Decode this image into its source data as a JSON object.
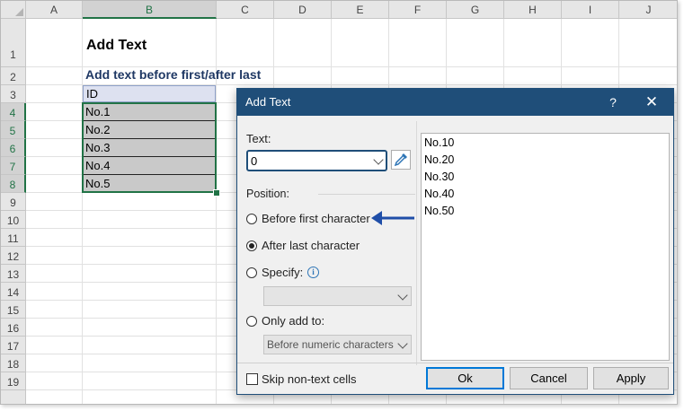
{
  "sheet": {
    "columns": [
      "A",
      "B",
      "C",
      "D",
      "E",
      "F",
      "G",
      "H",
      "I",
      "J"
    ],
    "rows": [
      "1",
      "2",
      "3",
      "4",
      "5",
      "6",
      "7",
      "8",
      "9",
      "10",
      "11",
      "12",
      "13",
      "14",
      "15",
      "16",
      "17",
      "18",
      "19"
    ],
    "title": "Add Text",
    "subtitle": "Add text before first/after last",
    "header": "ID",
    "data": [
      "No.1",
      "No.2",
      "No.3",
      "No.4",
      "No.5"
    ],
    "selection_color": "#217346"
  },
  "dialog": {
    "title": "Add Text",
    "help": "?",
    "close": "✕",
    "text_label": "Text:",
    "text_value": "0",
    "position_label": "Position:",
    "options": {
      "before_first": "Before first character",
      "after_last": "After last character",
      "specify": "Specify:",
      "only_add_to": "Only add to:"
    },
    "selected_option": "after_last",
    "only_add_to_value": "Before numeric characters",
    "preview": [
      "No.10",
      "No.20",
      "No.30",
      "No.40",
      "No.50"
    ],
    "skip_label": "Skip non-text cells",
    "buttons": {
      "ok": "Ok",
      "cancel": "Cancel",
      "apply": "Apply"
    },
    "accent_color": "#1f4e79",
    "arrow_color": "#1f4ea8"
  }
}
